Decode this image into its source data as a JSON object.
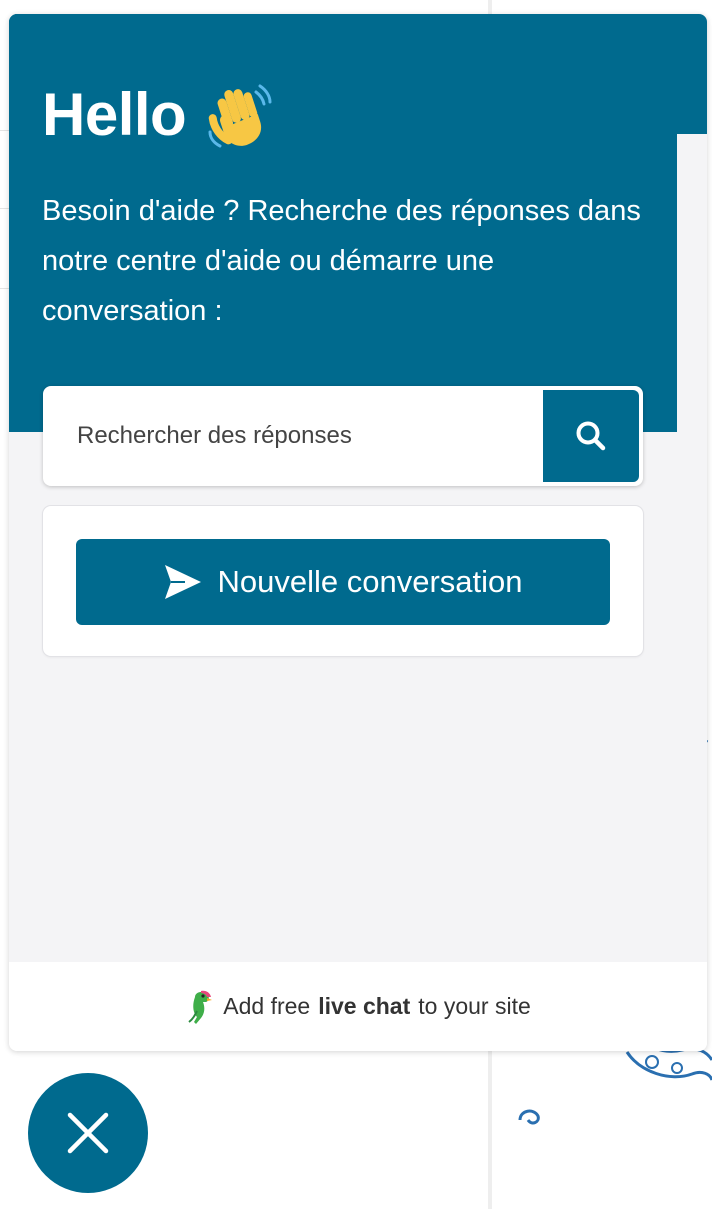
{
  "header": {
    "greeting": "Hello",
    "intro": "Besoin d'aide ? Recherche des réponses dans notre centre d'aide ou démarre une conversation :"
  },
  "search": {
    "placeholder": "Rechercher des réponses",
    "value": ""
  },
  "actions": {
    "new_conversation_label": "Nouvelle conversation"
  },
  "footer": {
    "prefix": "Add free",
    "bold": "live chat",
    "suffix": "to your site"
  },
  "icons": {
    "wave": "waving-hand-icon",
    "search": "search-icon",
    "send": "send-icon",
    "logo": "parrot-logo-icon",
    "close": "close-icon"
  },
  "colors": {
    "brand": "#006a8e",
    "panel_bg": "#f4f4f6",
    "text_on_brand": "#ffffff"
  }
}
